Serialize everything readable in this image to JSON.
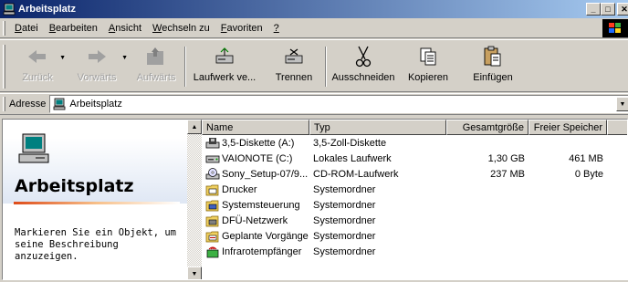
{
  "window": {
    "title": "Arbeitsplatz",
    "icon": "my-computer-icon",
    "buttons": {
      "minimize": "_",
      "maximize": "□",
      "close": "✕"
    }
  },
  "menu": {
    "items": [
      {
        "label": "Datei",
        "accel": "D",
        "rest": "atei"
      },
      {
        "label": "Bearbeiten",
        "accel": "B",
        "rest": "earbeiten"
      },
      {
        "label": "Ansicht",
        "accel": "A",
        "rest": "nsicht"
      },
      {
        "label": "Wechseln zu",
        "accel": "W",
        "rest": "echseln zu"
      },
      {
        "label": "Favoriten",
        "accel": "F",
        "rest": "avoriten"
      },
      {
        "label": "?",
        "accel": "?",
        "rest": ""
      }
    ]
  },
  "toolbar": {
    "back": "Zurück",
    "forward": "Vorwärts",
    "up": "Aufwärts",
    "map_drive": "Laufwerk ve...",
    "disconnect": "Trennen",
    "cut": "Ausschneiden",
    "copy": "Kopieren",
    "paste": "Einfügen"
  },
  "address": {
    "label": "Adresse",
    "value": "Arbeitsplatz"
  },
  "left_pane": {
    "title": "Arbeitsplatz",
    "description": "Markieren Sie ein Objekt, um seine Beschreibung anzuzeigen."
  },
  "columns": {
    "name": "Name",
    "type": "Typ",
    "total": "Gesamtgröße",
    "free": "Freier Speicher"
  },
  "items": [
    {
      "name": "3,5-Diskette (A:)",
      "type": "3,5-Zoll-Diskette",
      "total": "",
      "free": "",
      "icon": "floppy-drive-icon"
    },
    {
      "name": "VAIONOTE (C:)",
      "type": "Lokales Laufwerk",
      "total": "1,30 GB",
      "free": "461 MB",
      "icon": "hard-drive-icon"
    },
    {
      "name": "Sony_Setup-07/9...",
      "type": "CD-ROM-Laufwerk",
      "total": "237 MB",
      "free": "0 Byte",
      "icon": "cd-drive-icon"
    },
    {
      "name": "Drucker",
      "type": "Systemordner",
      "total": "",
      "free": "",
      "icon": "printers-folder-icon"
    },
    {
      "name": "Systemsteuerung",
      "type": "Systemordner",
      "total": "",
      "free": "",
      "icon": "control-panel-folder-icon"
    },
    {
      "name": "DFÜ-Netzwerk",
      "type": "Systemordner",
      "total": "",
      "free": "",
      "icon": "dialup-network-folder-icon"
    },
    {
      "name": "Geplante Vorgänge",
      "type": "Systemordner",
      "total": "",
      "free": "",
      "icon": "scheduled-tasks-folder-icon"
    },
    {
      "name": "Infrarotempfänger",
      "type": "Systemordner",
      "total": "",
      "free": "",
      "icon": "infrared-icon"
    }
  ],
  "colors": {
    "title_start": "#0a246a",
    "title_end": "#a6caf0",
    "face": "#d4d0c8",
    "accent_rule": "#de4c1a"
  }
}
